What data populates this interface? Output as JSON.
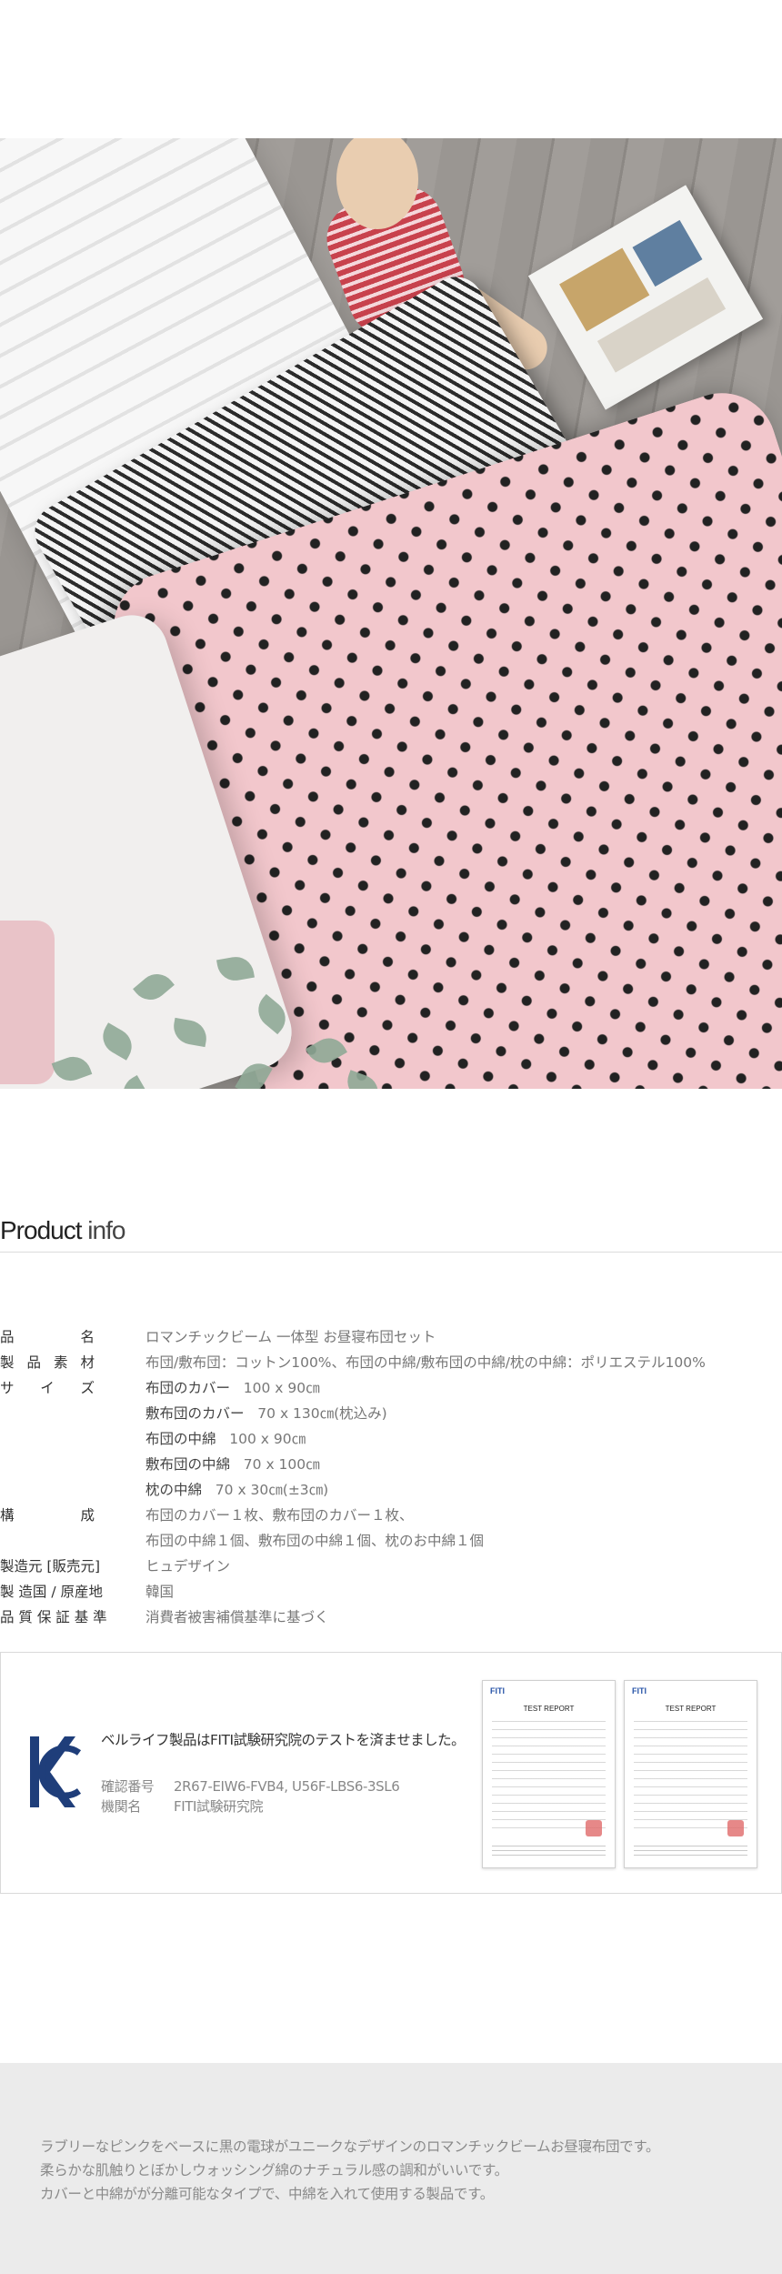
{
  "product_info": {
    "title_strong": "Product",
    "title_light": " info",
    "specs": [
      {
        "label": [
          "品",
          "名"
        ],
        "value": "ロマンチックビーム 一体型 お昼寝布団セット"
      },
      {
        "label": [
          "製",
          "品",
          "素",
          "材"
        ],
        "value": "布団/敷布団：コットン100%、布団の中綿/敷布団の中綿/枕の中綿：ポリエステル100%"
      },
      {
        "label": [
          "サ",
          "イ",
          "ズ"
        ],
        "lines": [
          {
            "name": "布団のカバー",
            "size": "100 x 90㎝"
          },
          {
            "name": "敷布団のカバー",
            "size": "70 x 130㎝(枕込み)"
          },
          {
            "name": "布団の中綿",
            "size": "100 x 90㎝"
          },
          {
            "name": "敷布団の中綿",
            "size": "70 x 100㎝"
          },
          {
            "name": "枕の中綿",
            "size": "70 x 30㎝(±3㎝)"
          }
        ]
      },
      {
        "label": [
          "構",
          "成"
        ],
        "lines": [
          "布団のカバー１枚、敷布団のカバー１枚、",
          "布団の中綿１個、敷布団の中綿１個、枕のお中綿１個"
        ]
      },
      {
        "label_text": "製造元 [販売元]",
        "value": "ヒュデザイン"
      },
      {
        "label_text": "製 造国 / 原産地",
        "value": "韓国"
      },
      {
        "label_text": "品 質 保 証 基 準",
        "value": "消費者被害補償基準に基づく"
      }
    ]
  },
  "certification": {
    "headline": "ベルライフ製品はFITI試験研究院のテストを済ませました。",
    "confirm_label": "確認番号",
    "confirm_value": "2R67-EIW6-FVB4, U56F-LBS6-3SL6",
    "agency_label": "機関名",
    "agency_value": "FITI試験研究院",
    "report_logo": "FITI",
    "report_title": "TEST REPORT"
  },
  "description": [
    "ラブリーなピンクをベースに黒の電球がユニークなデザインのロマンチックビームお昼寝布団です。",
    "柔らかな肌触りとぼかしウォッシング綿のナチュラル感の調和がいいです。",
    "カバーと中綿がが分離可能なタイプで、中綿を入れて使用する製品です。"
  ],
  "colors": {
    "duvet_pink": "#f2c7cc",
    "kc_blue": "#1f3e7a",
    "fiti_blue": "#2a56a8",
    "desc_bg": "#ebebeb"
  }
}
